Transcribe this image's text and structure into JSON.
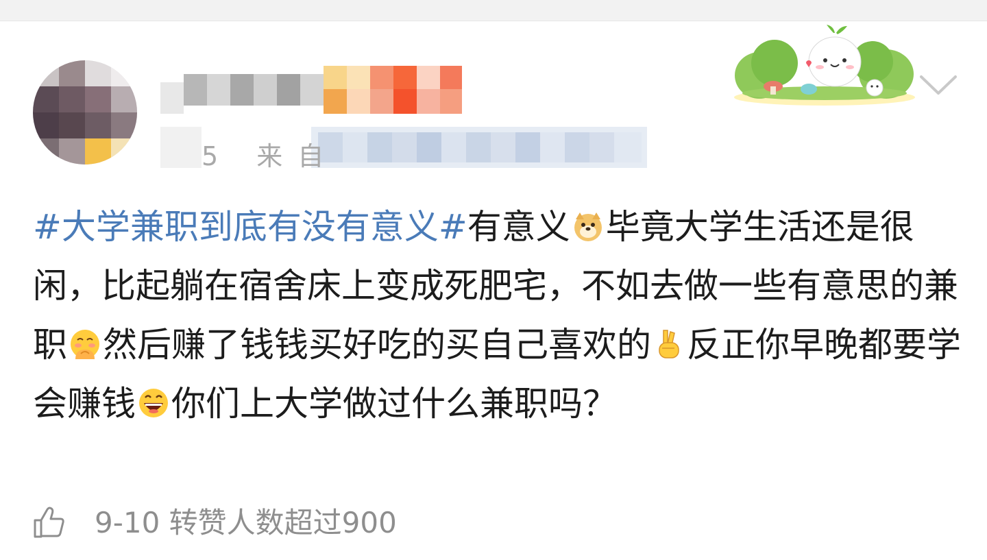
{
  "post": {
    "author": {
      "avatar_icon": "avatar-blurred",
      "name_redacted": true
    },
    "meta_visible": "5 来自",
    "sticker_icon": "sprout-character-sticker",
    "more_icon": "chevron-down-icon",
    "content": {
      "hashtag": "#大学兼职到底有没有意义#",
      "part1": "有意义",
      "emoji1": "doge-emoji",
      "part2": "毕竟大学生活还是很闲，比起躺在宿舍床上变成死肥宅，不如去做一些有意思的兼职",
      "emoji2": "shy-hug-emoji",
      "part3": "然后赚了钱钱买好吃的买自己喜欢的",
      "emoji3": "victory-hand-emoji",
      "part4": "反正你早晚都要学会赚钱",
      "emoji4": "laughing-emoji",
      "part5": "你们上大学做过什么兼职吗？"
    },
    "footer": {
      "like_icon": "thumbs-up-icon",
      "text": "9-10 转赞人数超过900"
    }
  }
}
